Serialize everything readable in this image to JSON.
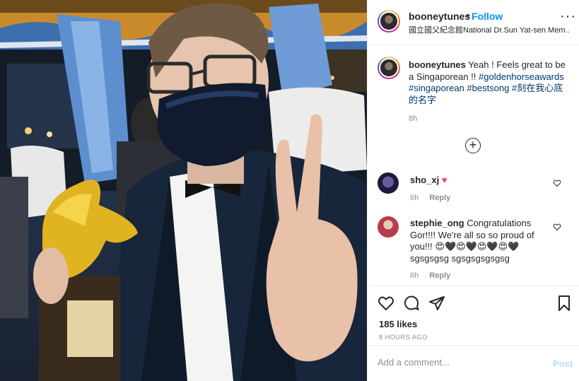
{
  "post": {
    "username": "booneytunes",
    "separator": "•",
    "follow_label": "Follow",
    "location": "國立國父紀念館National Dr.Sun Yat-sen Mem...",
    "more_icon": "more-horizontal-icon"
  },
  "caption": {
    "username": "booneytunes",
    "text": "Yeah ! Feels great to be a Singaporean !!",
    "hashtags": [
      "#goldenhorseawards",
      "#singaporean",
      "#bestsong",
      "#刻在我心底的名字"
    ],
    "time": "8h"
  },
  "load_more_icon": "plus-circle-icon",
  "comments": [
    {
      "username": "sho_xj",
      "text": "",
      "emoji": "♥",
      "time": "6h",
      "reply_label": "Reply"
    },
    {
      "username": "stephie_ong",
      "text": "Congratulations Gor!!!! We're all so so proud of you!!! 😍🖤😍🖤😍🖤😍🖤sgsgsgsg sgsgsgsgsgsg",
      "time": "6h",
      "reply_label": "Reply"
    }
  ],
  "actions": {
    "like_icon": "heart-icon",
    "comment_icon": "comment-icon",
    "share_icon": "send-icon",
    "save_icon": "bookmark-icon",
    "likes": "185 likes",
    "posted_ago": "8 HOURS AGO"
  },
  "composer": {
    "placeholder": "Add a comment...",
    "post_label": "Post"
  },
  "colors": {
    "link_blue": "#0095f6",
    "hashtag": "#00376b",
    "muted": "#8e8e8e",
    "heart_red": "#ed4956",
    "post_disabled": "#b2dffc"
  }
}
